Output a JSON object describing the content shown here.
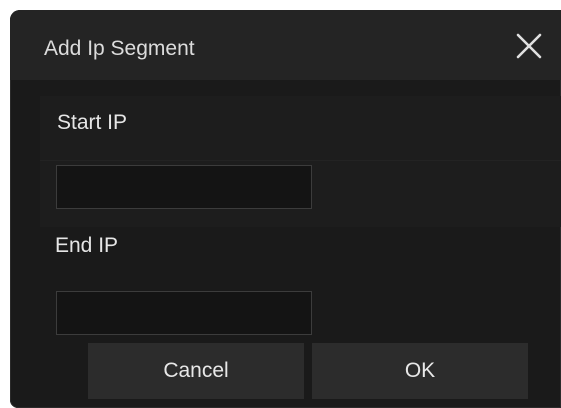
{
  "dialog": {
    "title": "Add Ip Segment",
    "close_icon": "close-icon",
    "start_ip": {
      "label": "Start IP",
      "value": "",
      "placeholder": ""
    },
    "end_ip": {
      "label": "End IP",
      "value": "",
      "placeholder": ""
    },
    "buttons": {
      "cancel_label": "Cancel",
      "ok_label": "OK"
    }
  },
  "colors": {
    "dialog_background": "#1a1a1a",
    "titlebar_background": "#242424",
    "button_background": "#2c2c2c",
    "text": "#e6e6e6"
  }
}
